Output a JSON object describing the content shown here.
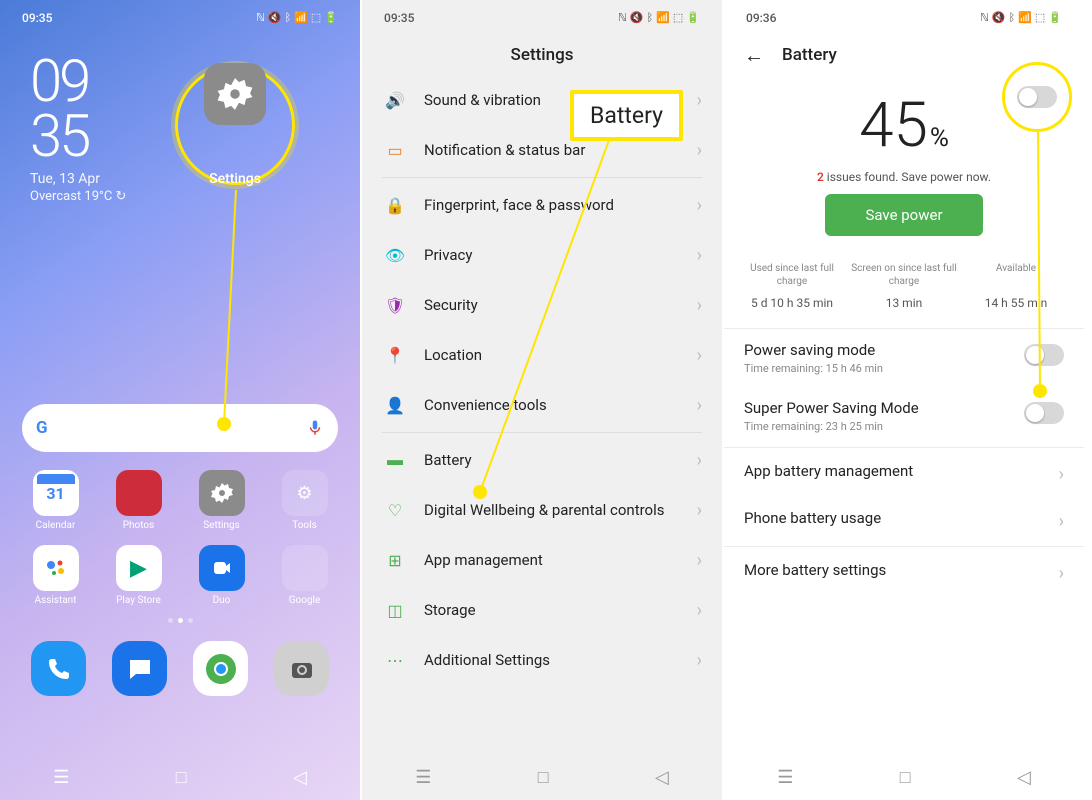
{
  "home": {
    "time_sb": "09:35",
    "clock_hh": "09",
    "clock_mm": "35",
    "date": "Tue, 13 Apr",
    "weather": "Overcast 19°C ↻",
    "hl_label": "Settings",
    "apps": [
      {
        "label": "Calendar"
      },
      {
        "label": "Photos"
      },
      {
        "label": "Settings"
      },
      {
        "label": "Tools"
      },
      {
        "label": "Assistant"
      },
      {
        "label": "Play Store"
      },
      {
        "label": "Duo"
      },
      {
        "label": "Google"
      }
    ],
    "cal_day": "31"
  },
  "settings": {
    "time_sb": "09:35",
    "title": "Settings",
    "rows": [
      {
        "icon": "sound",
        "label": "Sound & vibration",
        "color": "#4caf50"
      },
      {
        "icon": "notif",
        "label": "Notification & status bar",
        "color": "#e67e22"
      },
      {
        "sep": true
      },
      {
        "icon": "finger",
        "label": "Fingerprint, face & password",
        "color": "#ff9800"
      },
      {
        "icon": "privacy",
        "label": "Privacy",
        "color": "#00bcd4"
      },
      {
        "icon": "security",
        "label": "Security",
        "color": "#9c27b0"
      },
      {
        "icon": "location",
        "label": "Location",
        "color": "#ff5722"
      },
      {
        "icon": "tools",
        "label": "Convenience tools",
        "color": "#ffc107"
      },
      {
        "sep": true
      },
      {
        "icon": "battery",
        "label": "Battery",
        "color": "#4caf50"
      },
      {
        "icon": "wellbeing",
        "label": "Digital Wellbeing & parental controls",
        "color": "#4caf50"
      },
      {
        "icon": "apps",
        "label": "App management",
        "color": "#4caf50"
      },
      {
        "icon": "storage",
        "label": "Storage",
        "color": "#4caf50"
      },
      {
        "icon": "additional",
        "label": "Additional Settings",
        "color": "#4caf50"
      }
    ]
  },
  "battery": {
    "time_sb": "09:36",
    "title": "Battery",
    "pct": "45",
    "pct_sym": "%",
    "issues_n": "2",
    "issues_txt": " issues found. Save power now.",
    "save_btn": "Save power",
    "stats": [
      {
        "l": "Used since last full charge",
        "v": "5 d 10 h 35 min"
      },
      {
        "l": "Screen on since last full charge",
        "v": "13 min"
      },
      {
        "l": "Available",
        "v": "14 h 55 min"
      }
    ],
    "rows": [
      {
        "t": "Power saving mode",
        "s": "Time remaining:  15 h 46 min",
        "toggle": true
      },
      {
        "t": "Super Power Saving Mode",
        "s": "Time remaining:  23 h 25 min",
        "toggle": true
      },
      {
        "sep": true
      },
      {
        "t": "App battery management",
        "chev": true
      },
      {
        "t": "Phone battery usage",
        "chev": true
      },
      {
        "sep": true
      },
      {
        "t": "More battery settings",
        "chev": true
      }
    ]
  },
  "badge": "Battery"
}
